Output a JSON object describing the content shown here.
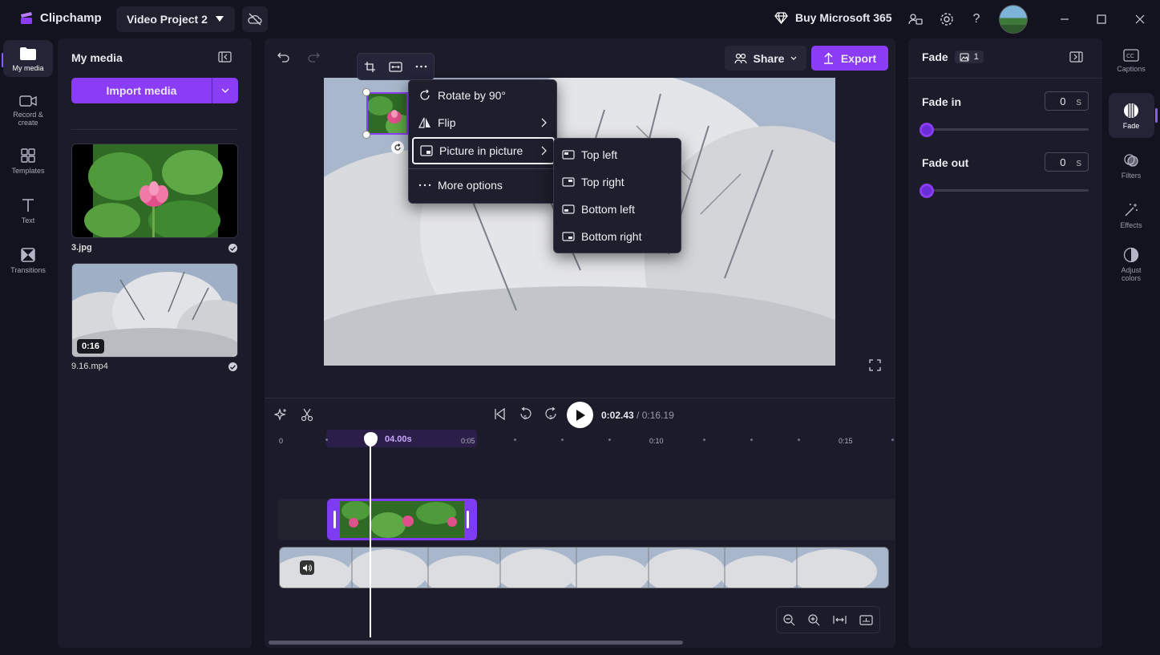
{
  "app": {
    "name": "Clipchamp",
    "project_title": "Video Project 2"
  },
  "titlebar": {
    "buy_label": "Buy Microsoft 365"
  },
  "left_rail": [
    {
      "label": "My media",
      "icon": "folder-icon"
    },
    {
      "label": "Record & create",
      "icon": "camera-icon"
    },
    {
      "label": "Templates",
      "icon": "templates-icon"
    },
    {
      "label": "Text",
      "icon": "text-icon"
    },
    {
      "label": "Transitions",
      "icon": "transitions-icon"
    }
  ],
  "media": {
    "title": "My media",
    "import_label": "Import media",
    "items": [
      {
        "name": "3.jpg"
      },
      {
        "name": "9.16.mp4",
        "duration": "0:16"
      }
    ]
  },
  "toolbar": {
    "share_label": "Share",
    "export_label": "Export"
  },
  "context_menu": {
    "items": [
      "Rotate by 90°",
      "Flip",
      "Picture in picture",
      "More options"
    ],
    "submenu": [
      "Top left",
      "Top right",
      "Bottom left",
      "Bottom right"
    ]
  },
  "playback": {
    "current_time": "0:02.43",
    "total_time": "/ 0:16.19"
  },
  "timeline": {
    "ruler_labels": [
      "0",
      "0:05",
      "0:10",
      "0:15"
    ],
    "clip_duration": "04.00s"
  },
  "fade": {
    "title": "Fade",
    "count": "1",
    "fade_in_label": "Fade in",
    "fade_in_value": "0",
    "fade_out_label": "Fade out",
    "fade_out_value": "0",
    "unit": "s"
  },
  "right_rail": [
    {
      "label": "Captions",
      "icon": "captions-icon"
    },
    {
      "label": "Fade",
      "icon": "fade-icon"
    },
    {
      "label": "Filters",
      "icon": "filters-icon"
    },
    {
      "label": "Effects",
      "icon": "effects-icon"
    },
    {
      "label": "Adjust colors",
      "icon": "adjust-colors-icon"
    }
  ],
  "colors": {
    "accent": "#8b3cf5",
    "background": "#131320",
    "panel": "#1b1b29"
  }
}
